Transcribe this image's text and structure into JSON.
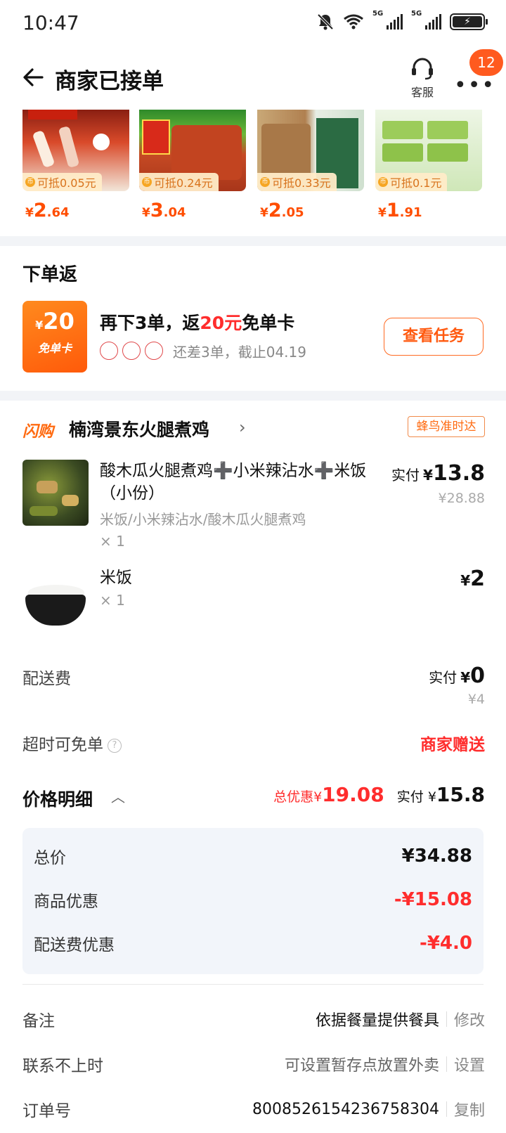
{
  "status_bar": {
    "time": "10:47",
    "sig1": "5G",
    "sig2": "5G"
  },
  "header": {
    "title": "商家已接单",
    "customer_service": "客服",
    "more": "•••",
    "badge": "12"
  },
  "products": [
    {
      "tag": "可抵0.05元",
      "yen": "¥",
      "int": "2",
      "dec": ".64"
    },
    {
      "tag": "可抵0.24元",
      "yen": "¥",
      "int": "3",
      "dec": ".04"
    },
    {
      "tag": "可抵0.33元",
      "yen": "¥",
      "int": "2",
      "dec": ".05"
    },
    {
      "tag": "可抵0.1元",
      "yen": "¥",
      "int": "1",
      "dec": ".91"
    }
  ],
  "return_section": {
    "title": "下单返",
    "card_amount_yen": "¥",
    "card_amount": "20",
    "card_label": "免单卡",
    "main_pre": "再下3单，返",
    "main_highlight": "20元",
    "main_post": "免单卡",
    "sub": "还差3单，截止04.19",
    "button": "查看任务"
  },
  "shop": {
    "logo": "闪购",
    "name": "楠湾景东火腿煮鸡",
    "chevron": "›",
    "delivery_tag": "蜂鸟准时达"
  },
  "items": [
    {
      "name": "酸木瓜火腿煮鸡➕小米辣沾水➕米饭（小份）",
      "options": "米饭/小米辣沾水/酸木瓜火腿煮鸡",
      "qty": "× 1",
      "pay_label": "实付",
      "yen": "¥",
      "pay": "13.8",
      "orig": "¥28.88"
    },
    {
      "name": "米饭",
      "qty": "× 1",
      "yen": "¥",
      "pay": "2"
    }
  ],
  "delivery": {
    "label": "配送费",
    "pay_label": "实付",
    "yen": "¥",
    "pay": "0",
    "orig": "¥4"
  },
  "overtime": {
    "label": "超时可免单",
    "help": "?",
    "value": "商家赠送"
  },
  "price_detail": {
    "title": "价格明细",
    "chevron": "︿",
    "discount_label": "总优惠",
    "discount_yen": "¥",
    "discount": "19.08",
    "actual_label": "实付",
    "actual_yen": "¥",
    "actual": "15.8",
    "rows": [
      {
        "label": "总价",
        "value": "¥34.88"
      },
      {
        "label": "商品优惠",
        "value": "-¥15.08"
      },
      {
        "label": "配送费优惠",
        "value": "-¥4.0"
      }
    ]
  },
  "info": [
    {
      "label": "备注",
      "value": "依据餐量提供餐具",
      "action": "修改"
    },
    {
      "label": "联系不上时",
      "value": "可设置暂存点放置外卖",
      "action": "设置"
    },
    {
      "label": "订单号",
      "value": "8008526154236758304",
      "action": "复制"
    }
  ]
}
